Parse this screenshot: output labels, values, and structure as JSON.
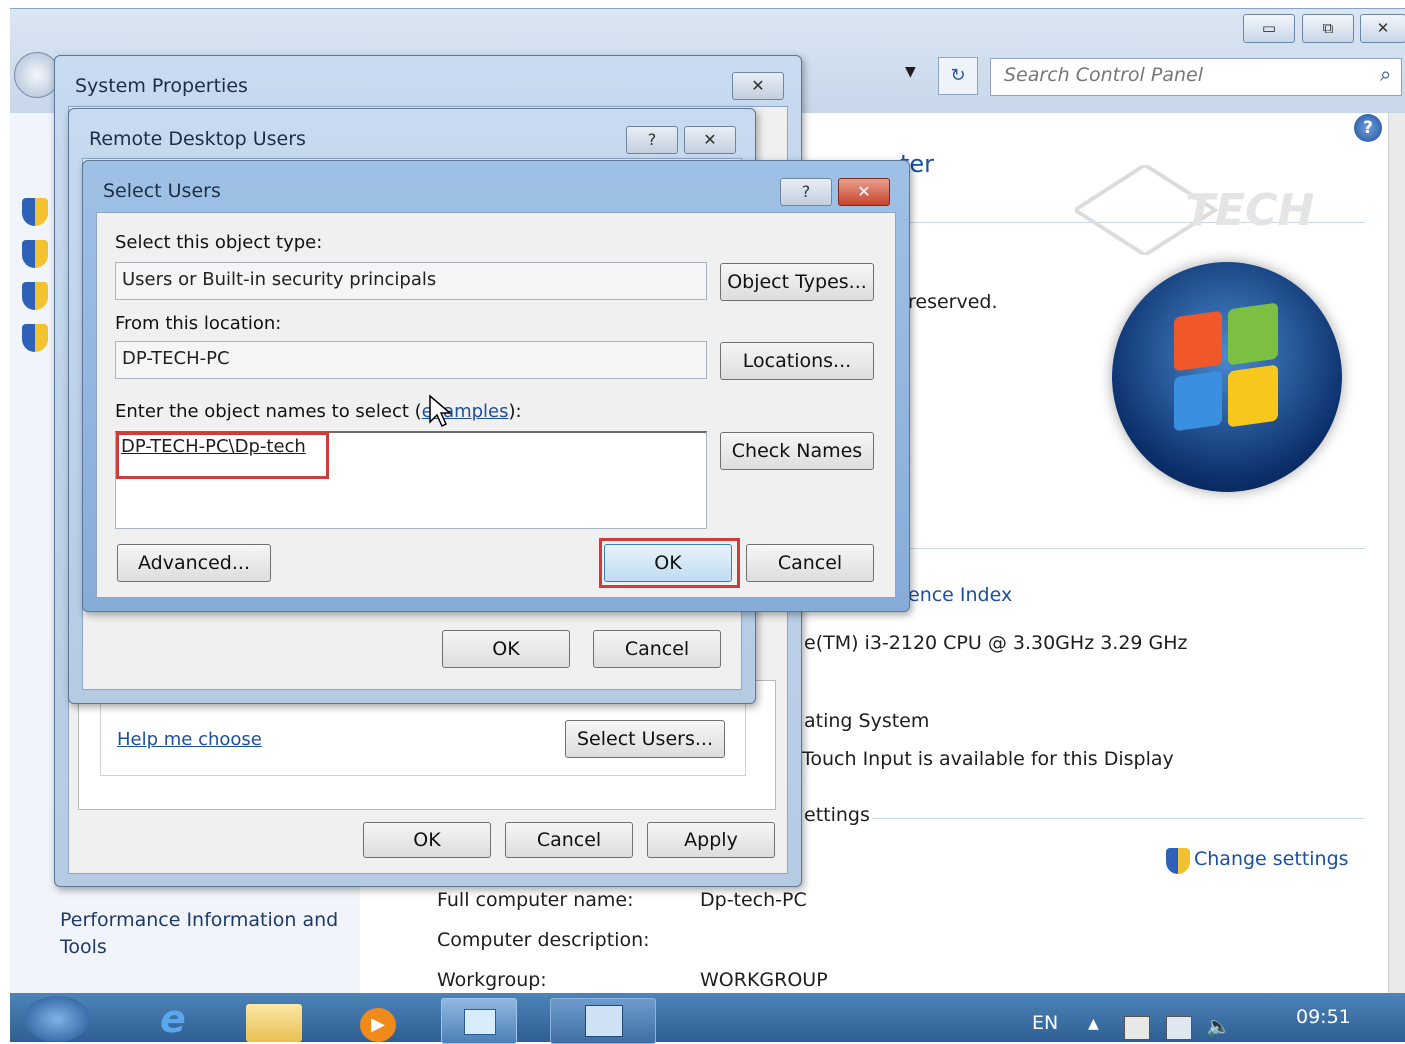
{
  "window": {
    "search_placeholder": "Search Control Panel",
    "partial_heading": "ter",
    "partial_copyright": "reserved.",
    "partial_index": "ence Index",
    "partial_processor": "e(TM) i3-2120 CPU @ 3.30GHz   3.29 GHz",
    "partial_os": "ating System",
    "partial_touch": "Touch Input is available for this Display",
    "partial_settings": "ettings",
    "change_settings": "Change settings",
    "full_name_label": "Full computer name:",
    "full_name_value": "Dp-tech-PC",
    "description_label": "Computer description:",
    "workgroup_label": "Workgroup:",
    "workgroup_value": "WORKGROUP",
    "sidebar_link": "Performance Information and Tools"
  },
  "system_properties": {
    "title": "System Properties",
    "help_link": "Help me choose",
    "select_users_button": "Select Users...",
    "ok": "OK",
    "cancel": "Cancel",
    "apply": "Apply"
  },
  "remote_users": {
    "title": "Remote Desktop Users",
    "ok": "OK",
    "cancel": "Cancel"
  },
  "select_users": {
    "title": "Select Users",
    "object_type_label": "Select this object type:",
    "object_type_value": "Users or Built-in security principals",
    "object_types_button": "Object Types...",
    "location_label": "From this location:",
    "location_value": "DP-TECH-PC",
    "locations_button": "Locations...",
    "names_label": "Enter the object names to select (",
    "examples_link": "examples",
    "names_label_end": "):",
    "names_value": "DP-TECH-PC\\Dp-tech",
    "check_names_button": "Check Names",
    "advanced_button": "Advanced...",
    "ok": "OK",
    "cancel": "Cancel"
  },
  "taskbar": {
    "language": "EN",
    "time": "09:51"
  },
  "colors": {
    "highlight": "#d23b3b",
    "link": "#1c4f9c"
  }
}
